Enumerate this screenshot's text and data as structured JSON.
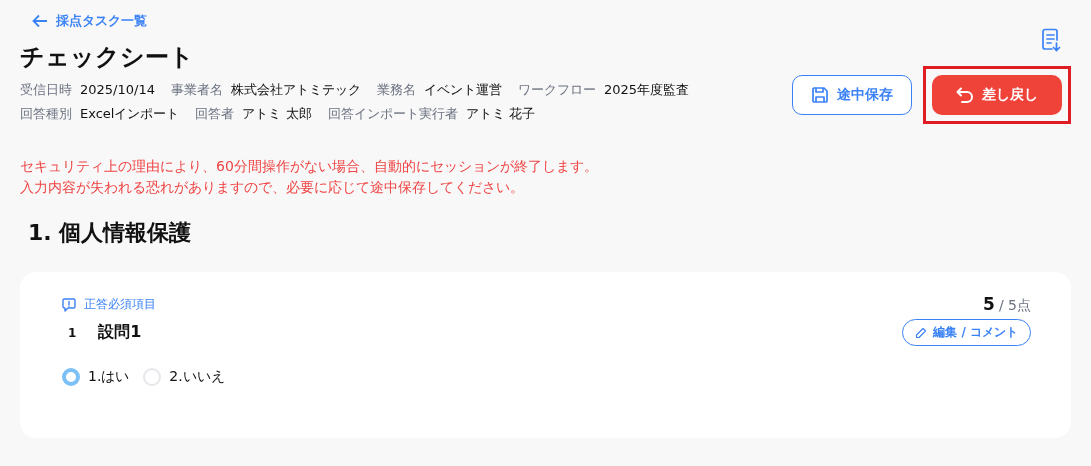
{
  "back_link": "採点タスク一覧",
  "title": "チェックシート",
  "meta_rows": [
    [
      {
        "label": "受信日時",
        "value": "2025/10/14"
      },
      {
        "label": "事業者名",
        "value": "株式会社アトミテック"
      },
      {
        "label": "業務名",
        "value": "イベント運営"
      },
      {
        "label": "ワークフロー",
        "value": "2025年度監査"
      }
    ],
    [
      {
        "label": "回答種別",
        "value": "Excelインポート"
      },
      {
        "label": "回答者",
        "value": "アトミ 太郎"
      },
      {
        "label": "回答インポート実行者",
        "value": "アトミ 花子"
      }
    ]
  ],
  "buttons": [
    {
      "kind": "save",
      "label": "途中保存",
      "highlighted": false
    },
    {
      "kind": "return",
      "label": "差し戻し",
      "highlighted": true
    }
  ],
  "warning": [
    "セキュリティ上の理由により、60分間操作がない場合、自動的にセッションが終了します。",
    "入力内容が失われる恐れがありますので、必要に応じて途中保存してください。"
  ],
  "section_title": "1. 個人情報保護",
  "questions": [
    {
      "required_label": "正答必須項目",
      "score": "5",
      "max_score": "/ 5点",
      "edit_button": "編集 / コメント",
      "number": "1",
      "title": "設問1",
      "options": [
        {
          "label": "1.はい",
          "selected": true
        },
        {
          "label": "2.いいえ",
          "selected": false
        }
      ]
    }
  ]
}
